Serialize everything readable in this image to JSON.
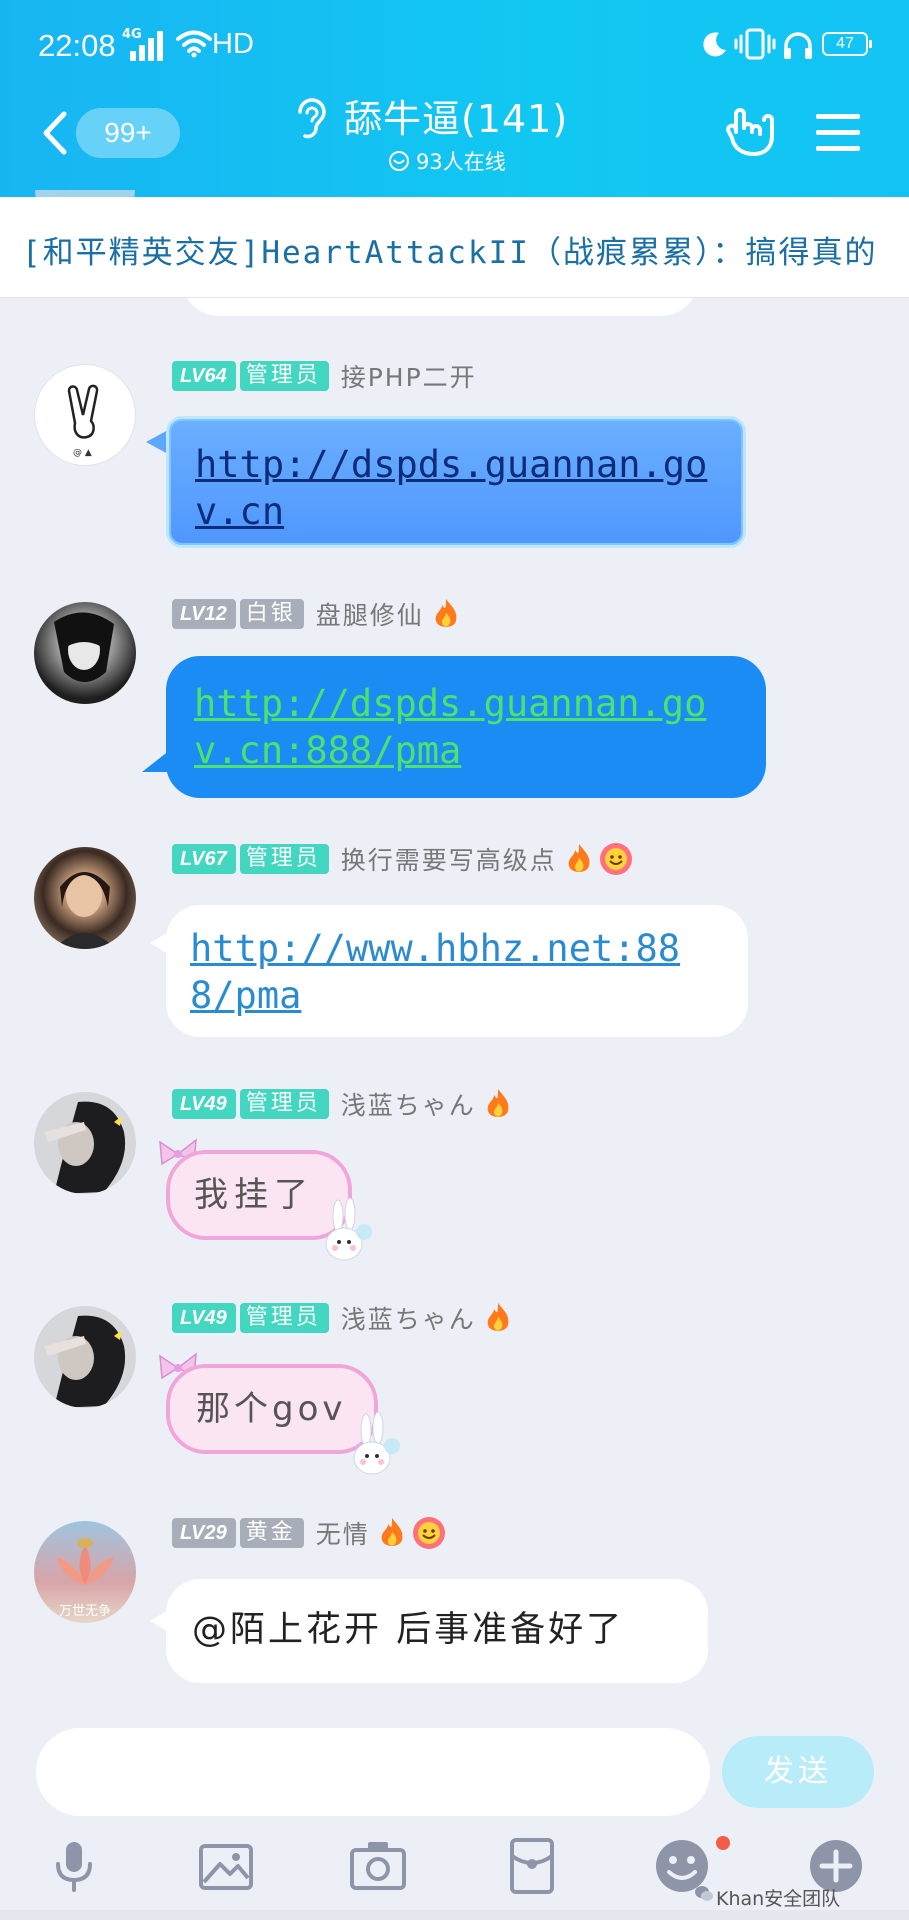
{
  "status_bar": {
    "time": "22:08",
    "network": "4G",
    "hd": "HD",
    "battery": "47"
  },
  "header": {
    "unread_badge": "99+",
    "title": "舔牛逼(141)",
    "online": "93人在线"
  },
  "announcement": "[和平精英交友]HeartAttackII（战痕累累）：搞得真的",
  "messages": [
    {
      "level": "LV64",
      "role": "管理员",
      "name": "接PHP二开",
      "text": "http://dspds.guannan.gov.cn",
      "style": "blue-glow"
    },
    {
      "level": "LV12",
      "role": "白银",
      "name": "盘腿修仙",
      "text": "http://dspds.guannan.gov.cn:888/pma",
      "style": "blue-green"
    },
    {
      "level": "LV67",
      "role": "管理员",
      "name": "换行需要写高级点",
      "text": "http://www.hbhz.net:888/pma",
      "style": "white-link"
    },
    {
      "level": "LV49",
      "role": "管理员",
      "name": "浅蓝ちゃん",
      "text": "我挂了",
      "style": "pink"
    },
    {
      "level": "LV49",
      "role": "管理员",
      "name": "浅蓝ちゃん",
      "text": "那个gov",
      "style": "pink"
    },
    {
      "level": "LV29",
      "role": "黄金",
      "name": "无情",
      "text": "@陌上花开 后事准备好了",
      "style": "white",
      "avatar_text": "万世无争"
    }
  ],
  "composer": {
    "input_value": "",
    "send_label": "发送"
  },
  "watermark": "Khan安全团队",
  "colors": {
    "header": "#18b5f3",
    "admin_badge": "#43d6c1",
    "gray_badge": "#a8aeb9",
    "background": "#eceff6"
  }
}
